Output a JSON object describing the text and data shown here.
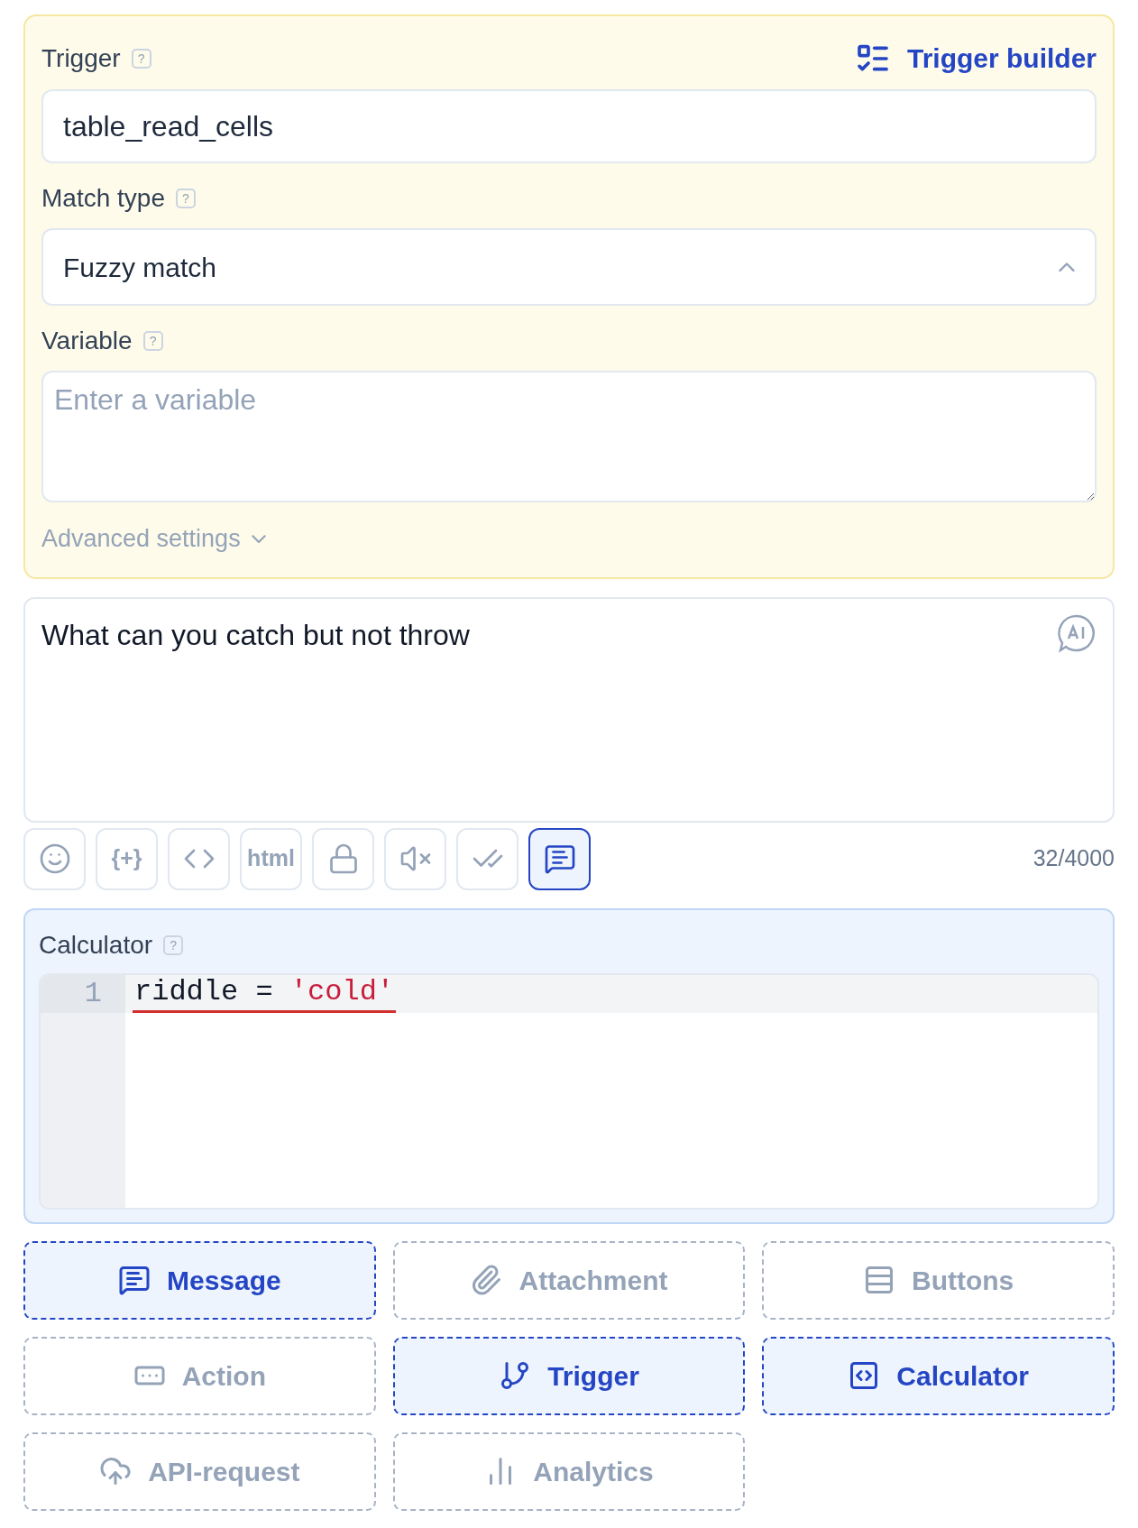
{
  "trigger_panel": {
    "trigger": {
      "label": "Trigger",
      "help": "?",
      "value": "table_read_cells"
    },
    "builder_link": "Trigger builder",
    "match_type": {
      "label": "Match type",
      "help": "?",
      "value": "Fuzzy match",
      "expanded": true
    },
    "variable": {
      "label": "Variable",
      "help": "?",
      "placeholder": "Enter a variable"
    },
    "advanced": {
      "label": "Advanced settings",
      "expanded": false
    }
  },
  "message": {
    "value": "What can you catch but not throw",
    "counter": "32/4000"
  },
  "toolbar": [
    {
      "kind": "icon",
      "selected": false
    },
    {
      "kind": "text",
      "label": "{+}",
      "selected": false
    },
    {
      "kind": "icon",
      "selected": false
    },
    {
      "kind": "text",
      "label": "html",
      "selected": false
    },
    {
      "kind": "icon",
      "selected": false
    },
    {
      "kind": "icon",
      "selected": false
    },
    {
      "kind": "icon",
      "selected": false
    },
    {
      "kind": "icon",
      "selected": true
    }
  ],
  "calculator": {
    "label": "Calculator",
    "help": "?",
    "line_number": "1",
    "tokens": [
      {
        "kind": "plain",
        "text": "riddle = "
      },
      {
        "kind": "string",
        "text": "'cold'"
      }
    ]
  },
  "blocks": [
    {
      "label": "Message",
      "selected": true
    },
    {
      "label": "Attachment",
      "selected": false
    },
    {
      "label": "Buttons",
      "selected": false
    },
    {
      "label": "Action",
      "selected": false
    },
    {
      "label": "Trigger",
      "selected": true
    },
    {
      "label": "Calculator",
      "selected": true
    },
    {
      "label": "API-request",
      "selected": false
    },
    {
      "label": "Analytics",
      "selected": false
    }
  ]
}
